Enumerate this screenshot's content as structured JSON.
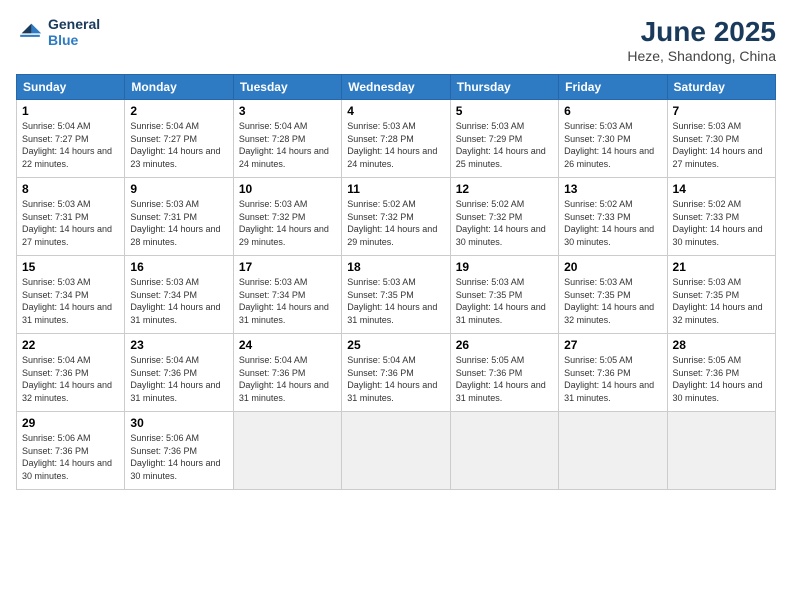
{
  "logo": {
    "line1": "General",
    "line2": "Blue"
  },
  "title": "June 2025",
  "location": "Heze, Shandong, China",
  "weekdays": [
    "Sunday",
    "Monday",
    "Tuesday",
    "Wednesday",
    "Thursday",
    "Friday",
    "Saturday"
  ],
  "days": [
    {
      "num": "1",
      "sunrise": "5:04 AM",
      "sunset": "7:27 PM",
      "daylight": "14 hours and 22 minutes."
    },
    {
      "num": "2",
      "sunrise": "5:04 AM",
      "sunset": "7:27 PM",
      "daylight": "14 hours and 23 minutes."
    },
    {
      "num": "3",
      "sunrise": "5:04 AM",
      "sunset": "7:28 PM",
      "daylight": "14 hours and 24 minutes."
    },
    {
      "num": "4",
      "sunrise": "5:03 AM",
      "sunset": "7:28 PM",
      "daylight": "14 hours and 24 minutes."
    },
    {
      "num": "5",
      "sunrise": "5:03 AM",
      "sunset": "7:29 PM",
      "daylight": "14 hours and 25 minutes."
    },
    {
      "num": "6",
      "sunrise": "5:03 AM",
      "sunset": "7:30 PM",
      "daylight": "14 hours and 26 minutes."
    },
    {
      "num": "7",
      "sunrise": "5:03 AM",
      "sunset": "7:30 PM",
      "daylight": "14 hours and 27 minutes."
    },
    {
      "num": "8",
      "sunrise": "5:03 AM",
      "sunset": "7:31 PM",
      "daylight": "14 hours and 27 minutes."
    },
    {
      "num": "9",
      "sunrise": "5:03 AM",
      "sunset": "7:31 PM",
      "daylight": "14 hours and 28 minutes."
    },
    {
      "num": "10",
      "sunrise": "5:03 AM",
      "sunset": "7:32 PM",
      "daylight": "14 hours and 29 minutes."
    },
    {
      "num": "11",
      "sunrise": "5:02 AM",
      "sunset": "7:32 PM",
      "daylight": "14 hours and 29 minutes."
    },
    {
      "num": "12",
      "sunrise": "5:02 AM",
      "sunset": "7:32 PM",
      "daylight": "14 hours and 30 minutes."
    },
    {
      "num": "13",
      "sunrise": "5:02 AM",
      "sunset": "7:33 PM",
      "daylight": "14 hours and 30 minutes."
    },
    {
      "num": "14",
      "sunrise": "5:02 AM",
      "sunset": "7:33 PM",
      "daylight": "14 hours and 30 minutes."
    },
    {
      "num": "15",
      "sunrise": "5:03 AM",
      "sunset": "7:34 PM",
      "daylight": "14 hours and 31 minutes."
    },
    {
      "num": "16",
      "sunrise": "5:03 AM",
      "sunset": "7:34 PM",
      "daylight": "14 hours and 31 minutes."
    },
    {
      "num": "17",
      "sunrise": "5:03 AM",
      "sunset": "7:34 PM",
      "daylight": "14 hours and 31 minutes."
    },
    {
      "num": "18",
      "sunrise": "5:03 AM",
      "sunset": "7:35 PM",
      "daylight": "14 hours and 31 minutes."
    },
    {
      "num": "19",
      "sunrise": "5:03 AM",
      "sunset": "7:35 PM",
      "daylight": "14 hours and 31 minutes."
    },
    {
      "num": "20",
      "sunrise": "5:03 AM",
      "sunset": "7:35 PM",
      "daylight": "14 hours and 32 minutes."
    },
    {
      "num": "21",
      "sunrise": "5:03 AM",
      "sunset": "7:35 PM",
      "daylight": "14 hours and 32 minutes."
    },
    {
      "num": "22",
      "sunrise": "5:04 AM",
      "sunset": "7:36 PM",
      "daylight": "14 hours and 32 minutes."
    },
    {
      "num": "23",
      "sunrise": "5:04 AM",
      "sunset": "7:36 PM",
      "daylight": "14 hours and 31 minutes."
    },
    {
      "num": "24",
      "sunrise": "5:04 AM",
      "sunset": "7:36 PM",
      "daylight": "14 hours and 31 minutes."
    },
    {
      "num": "25",
      "sunrise": "5:04 AM",
      "sunset": "7:36 PM",
      "daylight": "14 hours and 31 minutes."
    },
    {
      "num": "26",
      "sunrise": "5:05 AM",
      "sunset": "7:36 PM",
      "daylight": "14 hours and 31 minutes."
    },
    {
      "num": "27",
      "sunrise": "5:05 AM",
      "sunset": "7:36 PM",
      "daylight": "14 hours and 31 minutes."
    },
    {
      "num": "28",
      "sunrise": "5:05 AM",
      "sunset": "7:36 PM",
      "daylight": "14 hours and 30 minutes."
    },
    {
      "num": "29",
      "sunrise": "5:06 AM",
      "sunset": "7:36 PM",
      "daylight": "14 hours and 30 minutes."
    },
    {
      "num": "30",
      "sunrise": "5:06 AM",
      "sunset": "7:36 PM",
      "daylight": "14 hours and 30 minutes."
    }
  ]
}
